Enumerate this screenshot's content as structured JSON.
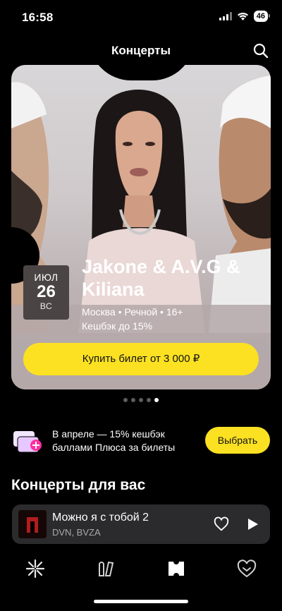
{
  "status": {
    "time": "16:58",
    "battery": "46"
  },
  "header": {
    "title": "Концерты"
  },
  "hero": {
    "month": "ИЮЛ",
    "day": "26",
    "weekday": "ВС",
    "title": "Jakone & A.V.G & Kiliana",
    "meta_line1": "Москва • Речной  • 16+",
    "meta_line2": "Кешбэк до 15%",
    "buy_label": "Купить билет от 3 000 ₽",
    "dots_total": 5,
    "dots_active_index": 4
  },
  "promo": {
    "text_line1": "В апреле — 15% кешбэк",
    "text_line2": "баллами Плюса за билеты",
    "button_label": "Выбрать"
  },
  "section": {
    "title": "Концерты для вас"
  },
  "player": {
    "track_title": "Можно я с тобой 2",
    "track_artist": "DVN, BVZA"
  },
  "tabs": [
    {
      "name": "home",
      "icon": "sparkle-icon"
    },
    {
      "name": "collection",
      "icon": "library-icon"
    },
    {
      "name": "concerts",
      "icon": "ticket-icon"
    },
    {
      "name": "favorites",
      "icon": "heart-icon"
    }
  ],
  "colors": {
    "accent": "#fbe122",
    "player_bg": "#2b2b2d",
    "date_badge": "#4b4445"
  }
}
